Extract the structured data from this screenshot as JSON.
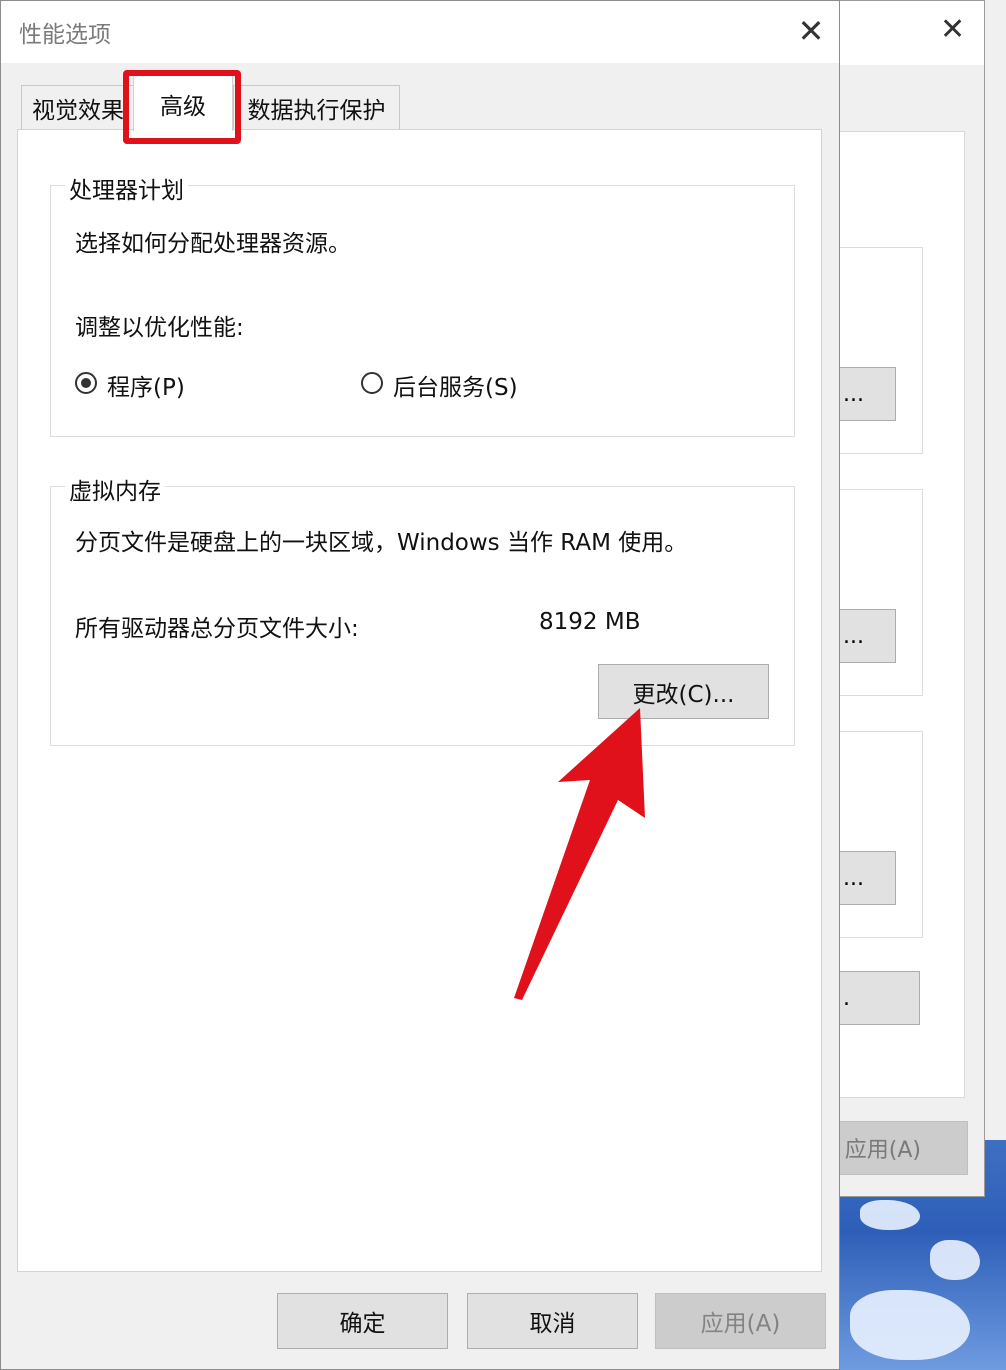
{
  "background_window": {
    "ellipsis_buttons": [
      "...",
      "...",
      "...",
      "."
    ],
    "apply_label": "应用(A)"
  },
  "dialog": {
    "title": "性能选项",
    "close_glyph": "✕",
    "tabs": [
      {
        "label": "视觉效果",
        "active": false
      },
      {
        "label": "高级",
        "active": true
      },
      {
        "label": "数据执行保护",
        "active": false
      }
    ],
    "processor_group": {
      "legend": "处理器计划",
      "description": "选择如何分配处理器资源。",
      "adjust_label": "调整以优化性能:",
      "options": [
        {
          "label": "程序(P)",
          "selected": true
        },
        {
          "label": "后台服务(S)",
          "selected": false
        }
      ]
    },
    "memory_group": {
      "legend": "虚拟内存",
      "description": "分页文件是硬盘上的一块区域，Windows 当作 RAM 使用。",
      "total_label": "所有驱动器总分页文件大小:",
      "total_value": "8192 MB",
      "change_button": "更改(C)..."
    },
    "footer": {
      "ok": "确定",
      "cancel": "取消",
      "apply": "应用(A)"
    }
  },
  "annotation": {
    "highlight_color": "#e0111b",
    "arrow_color": "#e0111b"
  }
}
